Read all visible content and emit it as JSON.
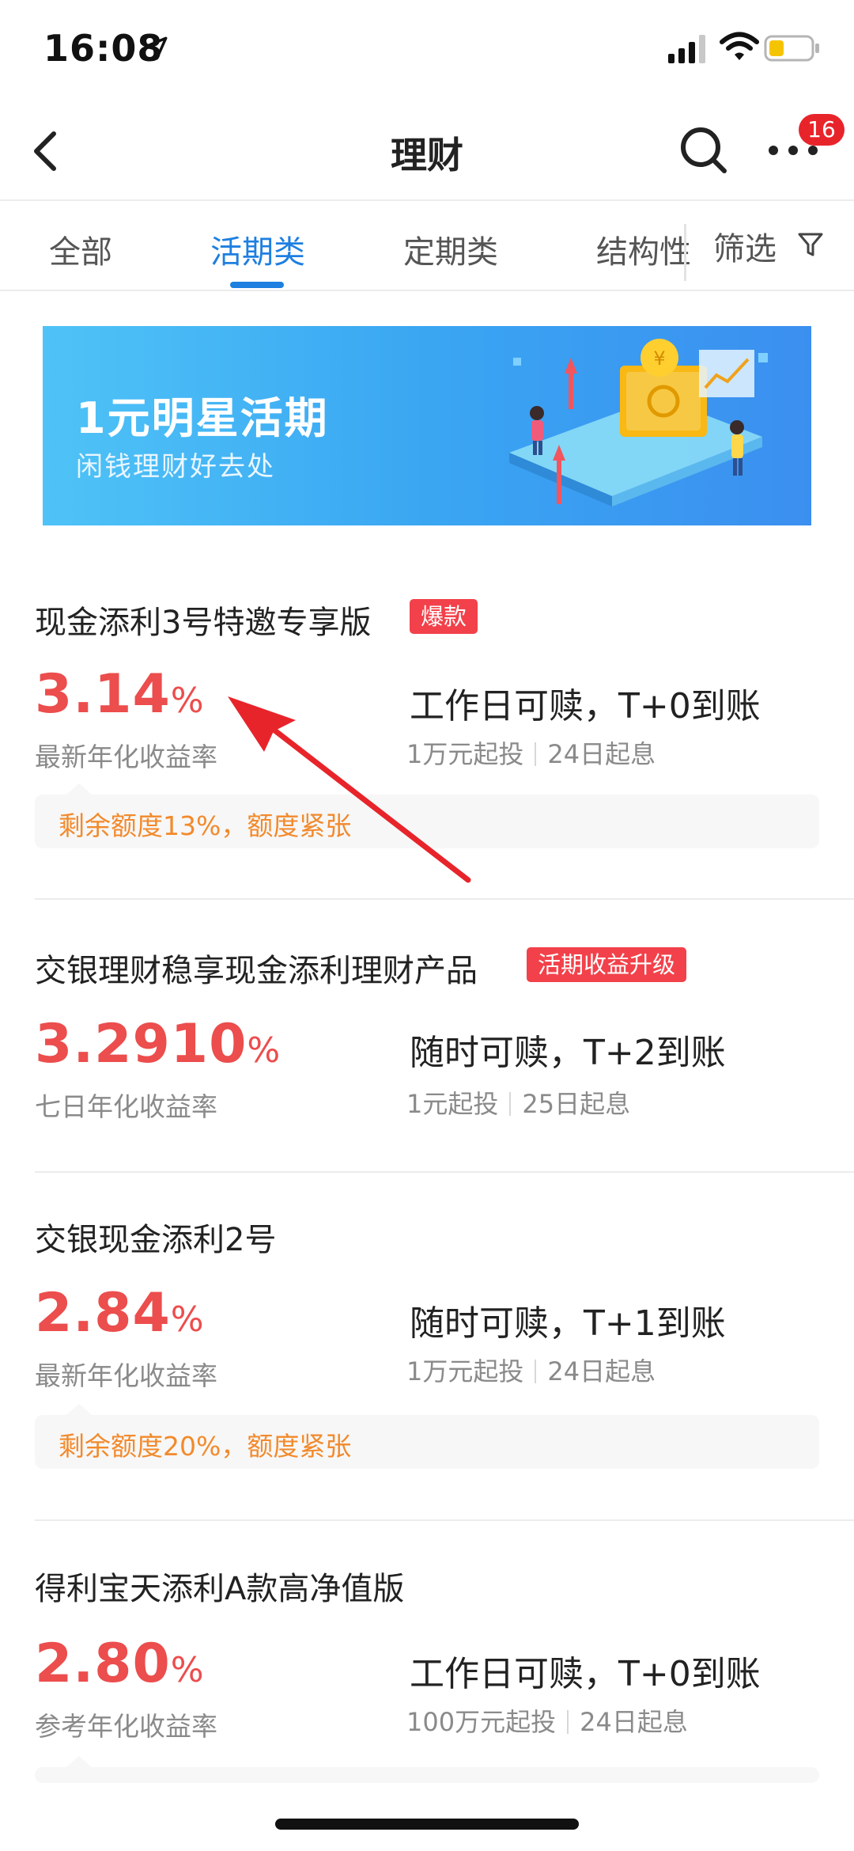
{
  "status_bar": {
    "time": "16:08"
  },
  "nav": {
    "title": "理财",
    "badge": "16"
  },
  "tabs": [
    {
      "label": "全部"
    },
    {
      "label": "活期类"
    },
    {
      "label": "定期类"
    },
    {
      "label": "结构性"
    }
  ],
  "filter": {
    "label": "筛选"
  },
  "banner": {
    "title": "1元明星活期",
    "subtitle": "闲钱理财好去处"
  },
  "products": [
    {
      "name": "现金添利3号特邀专享版",
      "tag": "爆款",
      "rate": "3.14",
      "rate_unit": "%",
      "rate_label": "最新年化收益率",
      "redeem": "工作日可赎，T+0到账",
      "min_invest": "1万元起投",
      "value_date": "24日起息",
      "quota_note": "剩余额度13%，额度紧张"
    },
    {
      "name": "交银理财稳享现金添利理财产品",
      "tag": "活期收益升级",
      "rate": "3.2910",
      "rate_unit": "%",
      "rate_label": "七日年化收益率",
      "redeem": "随时可赎，T+2到账",
      "min_invest": "1元起投",
      "value_date": "25日起息"
    },
    {
      "name": "交银现金添利2号",
      "rate": "2.84",
      "rate_unit": "%",
      "rate_label": "最新年化收益率",
      "redeem": "随时可赎，T+1到账",
      "min_invest": "1万元起投",
      "value_date": "24日起息",
      "quota_note": "剩余额度20%，额度紧张"
    },
    {
      "name": "得利宝天添利A款高净值版",
      "rate": "2.80",
      "rate_unit": "%",
      "rate_label": "参考年化收益率",
      "redeem": "工作日可赎，T+0到账",
      "min_invest": "100万元起投",
      "value_date": "24日起息"
    }
  ],
  "colors": {
    "accent_blue": "#1e7fe0",
    "rate_red": "#ec4d4d",
    "tag_red": "#f2414a",
    "quota_orange": "#f28a2c",
    "annotation_red": "#e8242b"
  }
}
